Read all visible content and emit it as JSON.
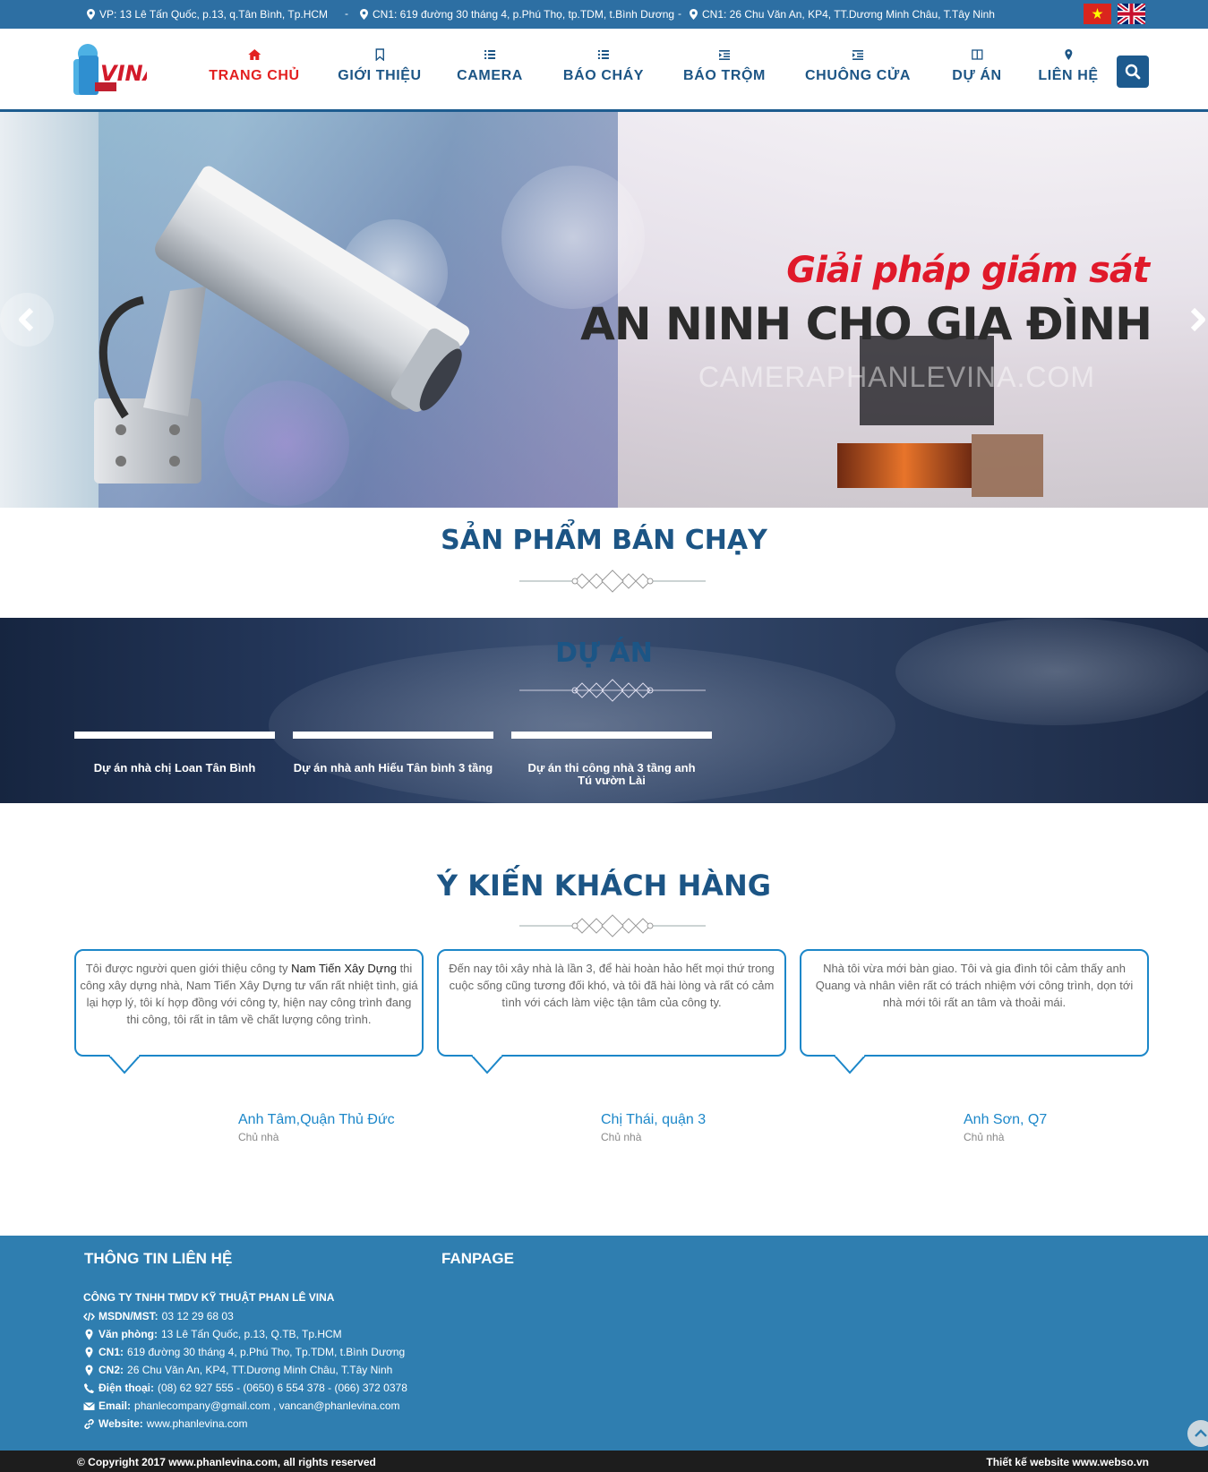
{
  "topbar": {
    "addr1": "VP: 13 Lê Tấn Quốc, p.13, q.Tân Bình, Tp.HCM",
    "sep1": "-",
    "addr2": "CN1: 619 đường 30 tháng 4, p.Phú Thọ, tp.TDM, t.Bình Dương",
    "sep2": "-",
    "addr3": "CN1: 26 Chu Văn An, KP4, TT.Dương Minh Châu, T.Tây Ninh"
  },
  "nav": {
    "items": [
      {
        "label": "TRANG CHỦ",
        "icon": "home-icon"
      },
      {
        "label": "GIỚI THIỆU",
        "icon": "bookmark-icon"
      },
      {
        "label": "CAMERA",
        "icon": "list-icon"
      },
      {
        "label": "BÁO CHÁY",
        "icon": "list-icon"
      },
      {
        "label": "BÁO TRỘM",
        "icon": "indent-icon"
      },
      {
        "label": "CHUÔNG CỬA",
        "icon": "indent-icon"
      },
      {
        "label": "DỰ ÁN",
        "icon": "columns-icon"
      },
      {
        "label": "LIÊN HỆ",
        "icon": "map-marker-icon"
      }
    ],
    "active_index": 0
  },
  "banner": {
    "title_line1": "Giải pháp giám sát",
    "title_line2": "AN NINH CHO GIA ĐÌNH",
    "watermark": "CAMERAPHANLEVINA.COM"
  },
  "sections": {
    "best_sellers": "SẢN PHẨM BÁN CHẠY",
    "projects": "DỰ ÁN",
    "testimonials": "Ý KIẾN KHÁCH HÀNG"
  },
  "projects": [
    {
      "title": "Dự án nhà chị Loan Tân Bình"
    },
    {
      "title": "Dự án nhà anh Hiếu Tân bình 3 tầng"
    },
    {
      "title": "Dự án thi công nhà 3 tầng anh Tú vườn Lài"
    }
  ],
  "testimonials": [
    {
      "pre": "Tôi được người quen giới thiệu công ty ",
      "link": "Nam Tiến Xây Dựng",
      "post": " thi công xây dựng nhà, Nam Tiến Xây Dựng tư vấn rất nhiệt tình, giá lại hợp lý, tôi kí hợp đồng với công ty, hiện nay công trình đang thi công, tôi rất in tâm về chất lượng công trình.",
      "name": "Anh Tâm,Quận Thủ Đức",
      "role": "Chủ nhà"
    },
    {
      "pre": "Đến nay tôi xây nhà là lần 3, để hài hoàn hảo hết mọi thứ trong cuộc sống cũng tương đối khó, và tôi đã hài lòng và rất có cảm tình với cách làm việc tận tâm của công ty.",
      "link": "",
      "post": "",
      "name": "Chị Thái, quận 3",
      "role": "Chủ nhà"
    },
    {
      "pre": "Nhà tôi vừa mới bàn giao. Tôi và gia đình tôi cảm thấy anh Quang và nhân viên rất có trách nhiệm với công trình, dọn tới nhà mới tôi rất an tâm và thoải mái.",
      "link": "",
      "post": "",
      "name": "Anh Sơn, Q7",
      "role": "Chủ nhà"
    }
  ],
  "footer": {
    "contact_heading": "THÔNG TIN LIÊN HỆ",
    "fanpage_heading": "FANPAGE",
    "company": "CÔNG TY TNHH TMDV KỸ THUẬT PHAN LÊ VINA",
    "lines": [
      {
        "icon": "code-icon",
        "label": "MSDN/MST:",
        "value": " 03 12 29 68 03"
      },
      {
        "icon": "map-marker-icon",
        "label": "Văn phòng:",
        "value": " 13 Lê Tấn Quốc, p.13, Q.TB, Tp.HCM"
      },
      {
        "icon": "map-marker-icon",
        "label": "CN1:",
        "value": " 619 đường 30 tháng 4, p.Phú Thọ, Tp.TDM, t.Bình Dương"
      },
      {
        "icon": "map-marker-icon",
        "label": "CN2:",
        "value": " 26 Chu Văn An, KP4, TT.Dương Minh Châu, T.Tây Ninh"
      },
      {
        "icon": "phone-icon",
        "label": "Điện thoại:",
        "value": " (08) 62 927 555 - (0650) 6 554 378 - (066) 372 0378"
      },
      {
        "icon": "envelope-icon",
        "label": "Email:",
        "value": " phanlecompany@gmail.com , vancan@phanlevina.com"
      },
      {
        "icon": "link-icon",
        "label": "Website:",
        "value": " www.phanlevina.com"
      }
    ],
    "copyright": "© Copyright 2017 www.phanlevina.com, all rights reserved",
    "designer": "Thiết kế website www.webso.vn"
  },
  "colors": {
    "topbar": "#2d6fa3",
    "nav_text": "#1c5585",
    "nav_active": "#e32020",
    "footer": "#2f7eb0",
    "bubble_border": "#1c87c9"
  }
}
